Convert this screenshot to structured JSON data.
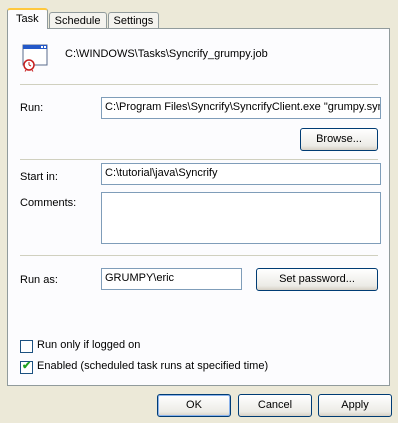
{
  "tabs": [
    {
      "label": "Task"
    },
    {
      "label": "Schedule"
    },
    {
      "label": "Settings"
    }
  ],
  "task": {
    "file_path": "C:\\WINDOWS\\Tasks\\Syncrify_grumpy.job",
    "run_label": "Run:",
    "run_value": "C:\\Program Files\\Syncrify\\SyncrifyClient.exe \"grumpy.syn",
    "browse_label": "Browse...",
    "start_in_label": "Start in:",
    "start_in_value": "C:\\tutorial\\java\\Syncrify",
    "comments_label": "Comments:",
    "comments_value": "",
    "run_as_label": "Run as:",
    "run_as_value": "GRUMPY\\eric",
    "set_password_label": "Set password...",
    "run_only_logged_on_label": "Run only if logged on",
    "run_only_logged_on_checked": false,
    "enabled_label": "Enabled (scheduled task runs at specified time)",
    "enabled_checked": true
  },
  "buttons": {
    "ok": "OK",
    "cancel": "Cancel",
    "apply": "Apply"
  },
  "icons": {
    "task_icon": "scheduled-task-window-clock-icon",
    "check_mark": "checkmark-icon"
  },
  "colors": {
    "dialog_bg": "#ece9d8",
    "panel_bg": "#fcfcfe",
    "active_tab_accent": "#ffc83c",
    "field_border": "#7f9db9"
  }
}
